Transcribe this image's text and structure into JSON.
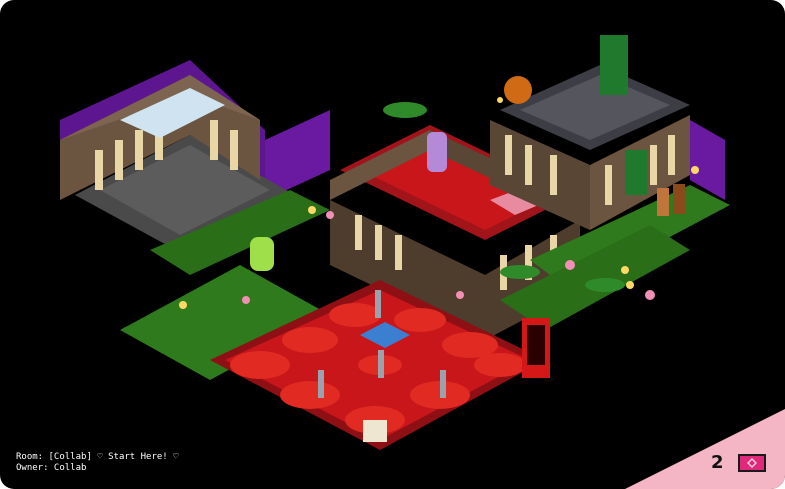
{
  "room": {
    "name_line": "Room: [Collab] ♡ Start Here! ♡",
    "owner_line": "Owner: Collab"
  },
  "badge": {
    "count": "2",
    "icon": "pink-diamond-ticket-icon"
  },
  "colors": {
    "background": "#000000",
    "floor_red": "#c8161a",
    "wall_purple": "#6a1aa0",
    "stone_brown": "#5a4634",
    "grass_green": "#2f7a1c",
    "corner_pink": "#f4b6c4",
    "badge_magenta": "#e0297a"
  }
}
